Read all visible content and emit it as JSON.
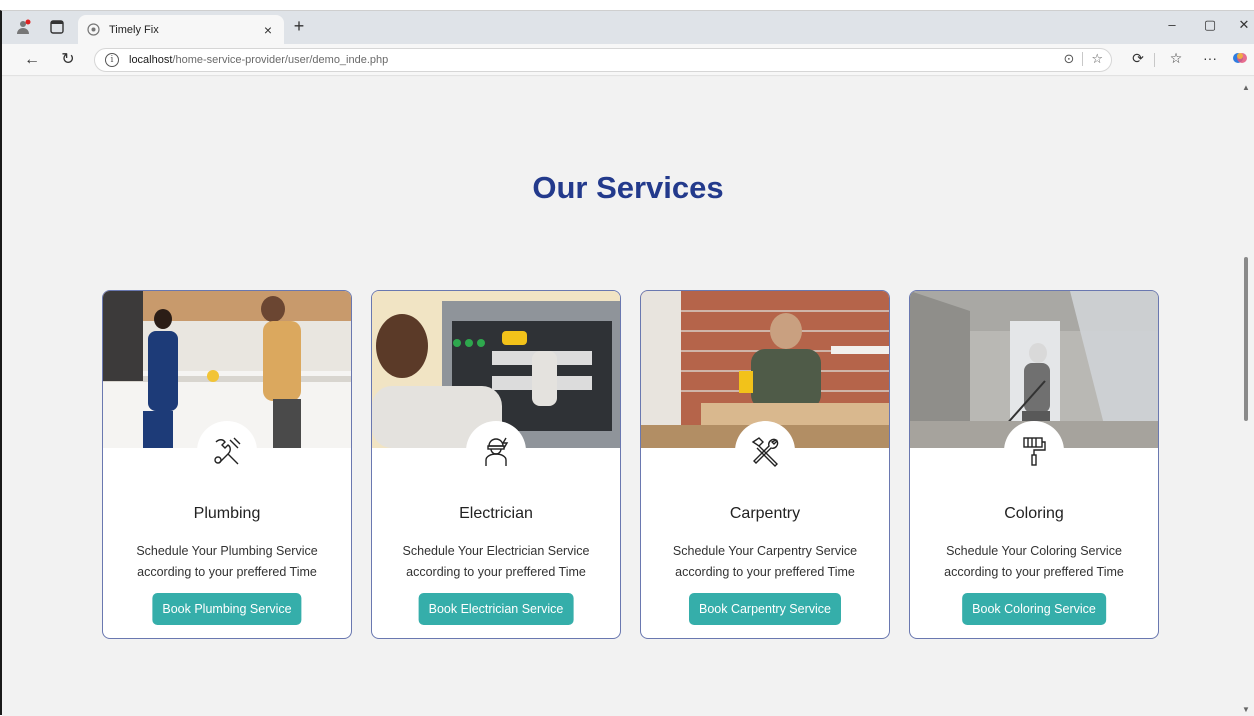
{
  "browser": {
    "tab_title": "Timely Fix",
    "url_host": "localhost",
    "url_path": "/home-service-provider/user/demo_inde.php"
  },
  "page": {
    "heading": "Our Services",
    "colors": {
      "heading": "#233a8c",
      "button": "#35aeaa",
      "card_border": "#6a78b0"
    },
    "services": [
      {
        "name": "Plumbing",
        "desc_line1": "Schedule Your Plumbing Service",
        "desc_line2": "according to your preffered Time",
        "button": "Book Plumbing Service",
        "icon": "plumbing-tools-icon"
      },
      {
        "name": "Electrician",
        "desc_line1": "Schedule Your Electrician Service",
        "desc_line2": "according to your preffered Time",
        "button": "Book Electrician Service",
        "icon": "electrician-icon"
      },
      {
        "name": "Carpentry",
        "desc_line1": "Schedule Your Carpentry Service",
        "desc_line2": "according to your preffered Time",
        "button": "Book Carpentry Service",
        "icon": "hammer-wrench-icon"
      },
      {
        "name": "Coloring",
        "desc_line1": "Schedule Your Coloring Service",
        "desc_line2": "according to your preffered Time",
        "button": "Book Coloring Service",
        "icon": "paint-roller-icon"
      }
    ]
  }
}
